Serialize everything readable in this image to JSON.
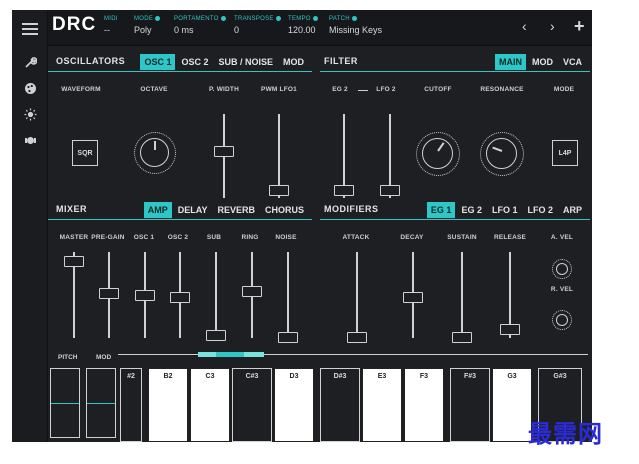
{
  "app": {
    "name": "DRC"
  },
  "header": {
    "fields": [
      {
        "label": "MIDI",
        "value": "--"
      },
      {
        "label": "MODE",
        "value": "Poly"
      },
      {
        "label": "PORTAMENTO",
        "value": "0 ms"
      },
      {
        "label": "TRANSPOSE",
        "value": "0"
      },
      {
        "label": "TEMPO",
        "value": "120.00"
      },
      {
        "label": "PATCH",
        "value": "Missing Keys"
      }
    ],
    "prev": "‹",
    "next": "›",
    "add": "+"
  },
  "sidebar": {
    "icons": [
      "menu-icon",
      "wrench-icon",
      "palette-icon",
      "brightness-icon",
      "record-icon"
    ]
  },
  "oscillators": {
    "title": "OSCILLATORS",
    "tabs": [
      "OSC 1",
      "OSC 2",
      "SUB / NOISE",
      "MOD"
    ],
    "active_tab": "OSC 1",
    "labels": {
      "waveform": "WAVEFORM",
      "octave": "OCTAVE",
      "pwidth": "P. WIDTH",
      "pwm": "PWM LFO1"
    },
    "waveform_value": "SQR",
    "octave_knob_level": 0.5,
    "pwidth_level": 0.6,
    "pwm_level": 0.0
  },
  "filter": {
    "title": "FILTER",
    "tabs": [
      "MAIN",
      "MOD",
      "VCA"
    ],
    "active_tab": "MAIN",
    "labels": {
      "eg2": "EG 2",
      "lfo2": "LFO 2",
      "cutoff": "CUTOFF",
      "resonance": "RESONANCE",
      "mode": "MODE"
    },
    "mode_value": "L4P",
    "eg2_level": 0.0,
    "lfo2_level": 0.0
  },
  "mixer": {
    "title": "MIXER",
    "tabs": [
      "AMP",
      "DELAY",
      "REVERB",
      "CHORUS"
    ],
    "active_tab": "AMP",
    "sliders": [
      {
        "label": "MASTER",
        "level": 0.9
      },
      {
        "label": "PRE-GAIN",
        "level": 0.55
      },
      {
        "label": "OSC 1",
        "level": 0.55
      },
      {
        "label": "OSC 2",
        "level": 0.5
      },
      {
        "label": "SUB",
        "level": 0.0
      },
      {
        "label": "RING",
        "level": 0.55
      },
      {
        "label": "NOISE",
        "level": 0.0
      }
    ]
  },
  "modifiers": {
    "title": "MODIFIERS",
    "tabs": [
      "EG 1",
      "EG 2",
      "LFO 1",
      "LFO 2",
      "ARP"
    ],
    "active_tab": "EG 1",
    "sliders": [
      {
        "label": "ATTACK",
        "level": 0.0
      },
      {
        "label": "DECAY",
        "level": 0.5
      },
      {
        "label": "SUSTAIN",
        "level": 0.0
      },
      {
        "label": "RELEASE",
        "level": 0.1
      }
    ],
    "knobs": [
      {
        "label": "A. VEL"
      },
      {
        "label": "R. VEL"
      }
    ]
  },
  "keyboard": {
    "pitch_label": "PITCH",
    "mod_label": "MOD",
    "keys": [
      {
        "label": "#2",
        "white": false
      },
      {
        "label": "B2",
        "white": true
      },
      {
        "label": "C3",
        "white": true
      },
      {
        "label": "C#3",
        "white": false
      },
      {
        "label": "D3",
        "white": true
      },
      {
        "label": "D#3",
        "white": false
      },
      {
        "label": "E3",
        "white": true
      },
      {
        "label": "F3",
        "white": true
      },
      {
        "label": "F#3",
        "white": false
      },
      {
        "label": "G3",
        "white": true
      },
      {
        "label": "G#3",
        "white": false
      }
    ]
  },
  "watermark": "最需网",
  "colors": {
    "accent": "#2ec6c6",
    "background": "#1d1f22",
    "text": "#d8dadc"
  }
}
